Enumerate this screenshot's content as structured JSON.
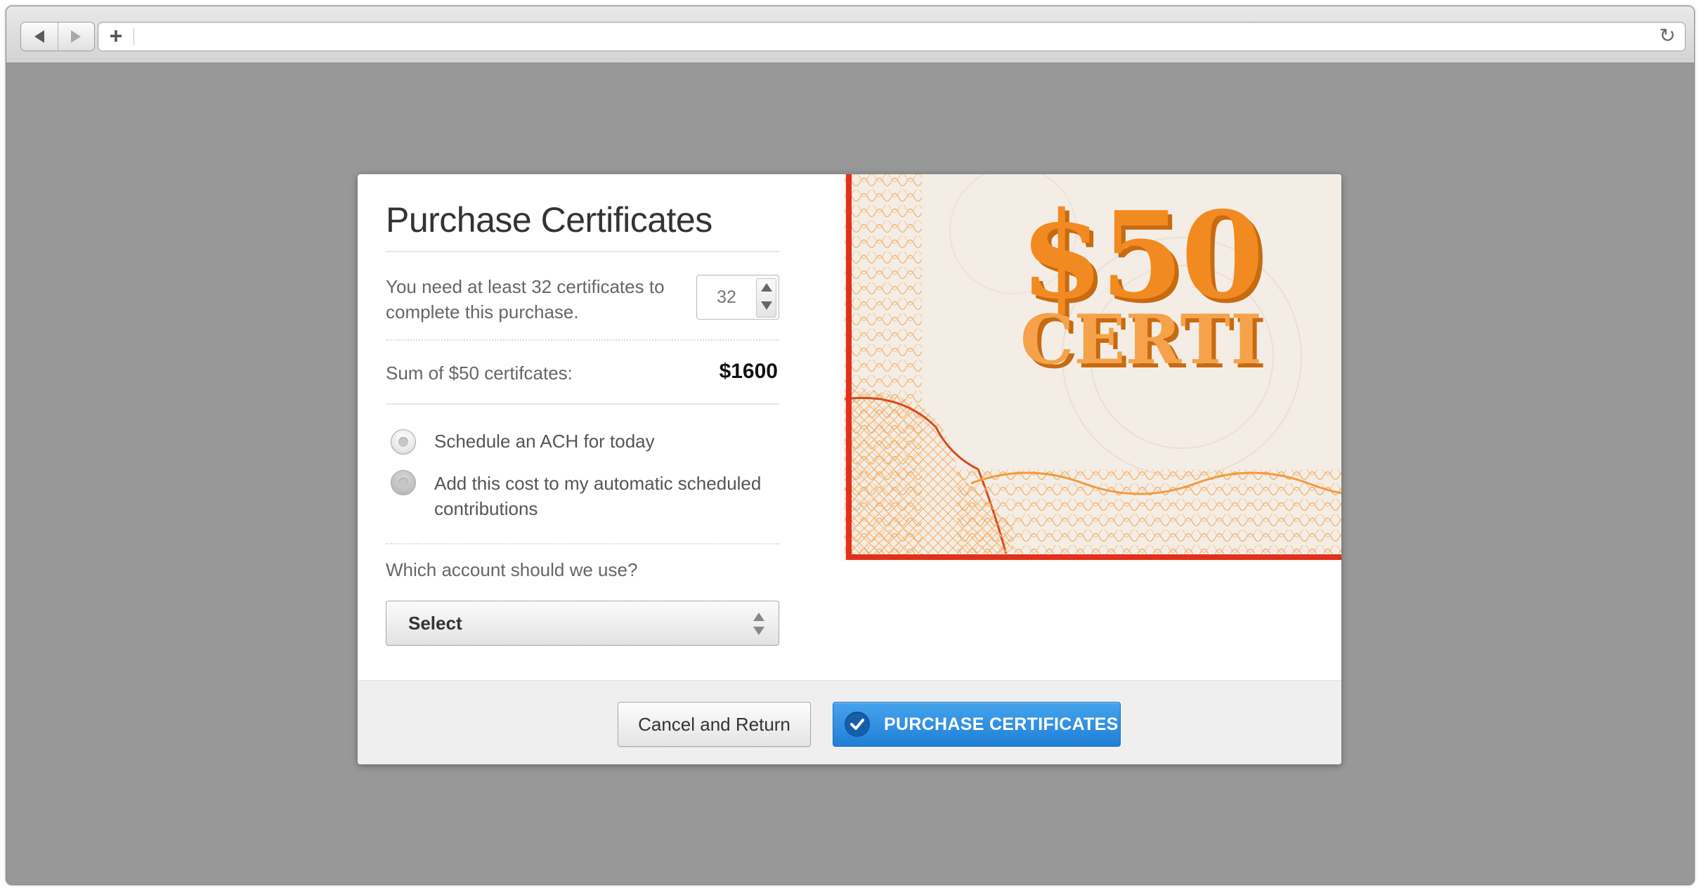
{
  "browser": {
    "back_icon": "back-arrow-icon",
    "forward_icon": "forward-arrow-icon",
    "new_tab_icon": "plus-icon",
    "reload_icon": "reload-icon",
    "reload_glyph": "↻",
    "plus_glyph": "+",
    "address_value": ""
  },
  "modal": {
    "title": "Purchase Certificates",
    "need_text": "You need at least 32 certificates to complete this purchase.",
    "quantity": "32",
    "sum_label": "Sum of $50 certifcates:",
    "sum_value": "$1600",
    "payment_options": [
      {
        "label": "Schedule an ACH for today",
        "selected": false
      },
      {
        "label": "Add this cost to my automatic scheduled contributions",
        "selected": false
      }
    ],
    "account_question": "Which account should we use?",
    "account_select": "Select"
  },
  "certificate": {
    "amount_text": "$50",
    "word_text": "CERTI",
    "colors": {
      "orange": "#f08a1c",
      "border_red": "#e0321a",
      "paper": "#f3ede6"
    }
  },
  "footer": {
    "cancel_label": "Cancel and Return",
    "purchase_label": "PURCHASE CERTIFICATES",
    "purchase_icon": "check-icon"
  },
  "colors": {
    "backdrop": "#989898",
    "primary_button": "#2b8ee0",
    "text": "#666666"
  }
}
